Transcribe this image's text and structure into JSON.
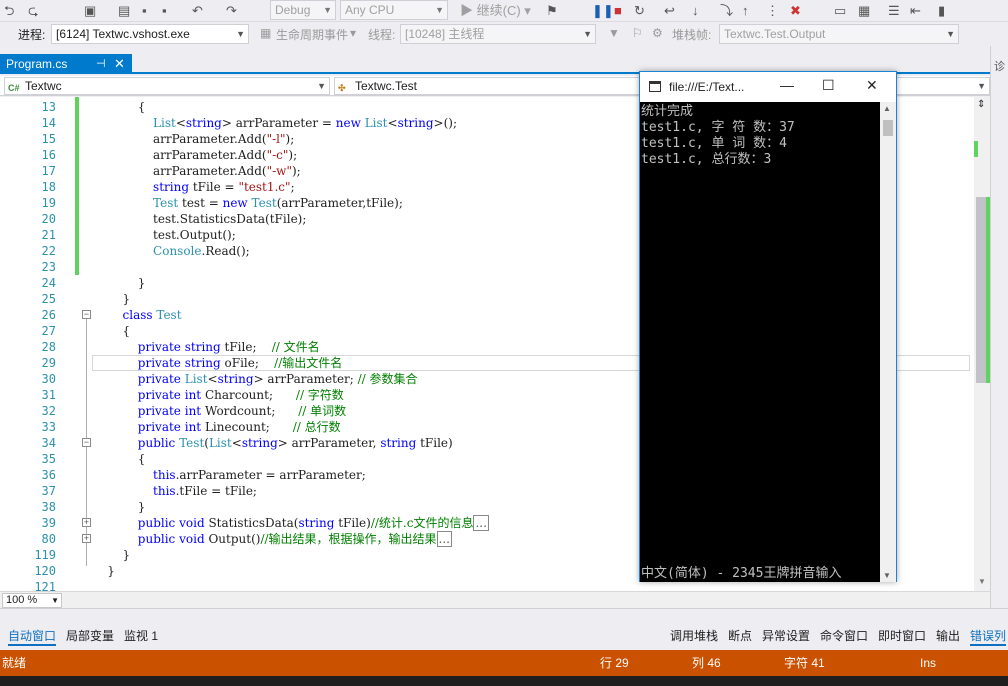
{
  "toolbar": {
    "config": "Debug",
    "platform": "Any CPU",
    "continue": "继续(C)"
  },
  "debug_bar": {
    "process_label": "进程:",
    "process_value": "[6124] Textwc.vshost.exe",
    "lifecycle": "生命周期事件",
    "thread_label": "线程:",
    "thread_value": "[10248] 主线程",
    "stack_label": "堆栈帧:",
    "stack_value": "Textwc.Test.Output"
  },
  "tab": {
    "name": "Program.cs",
    "pin": "⊣",
    "close": "✕"
  },
  "nav": {
    "project": "Textwc",
    "class": "Textwc.Test"
  },
  "code": [
    {
      "n": "13",
      "t": "            {"
    },
    {
      "n": "14",
      "t": "                <span class=\"t\">List</span>&lt;<span class=\"k\">string</span>&gt; arrParameter = <span class=\"k\">new</span> <span class=\"t\">List</span>&lt;<span class=\"k\">string</span>&gt;();"
    },
    {
      "n": "15",
      "t": "                arrParameter.Add(<span class=\"s\">\"-l\"</span>);"
    },
    {
      "n": "16",
      "t": "                arrParameter.Add(<span class=\"s\">\"-c\"</span>);"
    },
    {
      "n": "17",
      "t": "                arrParameter.Add(<span class=\"s\">\"-w\"</span>);"
    },
    {
      "n": "18",
      "t": "                <span class=\"k\">string</span> tFile = <span class=\"s\">\"test1.c\"</span>;"
    },
    {
      "n": "19",
      "t": "                <span class=\"t\">Test</span> test = <span class=\"k\">new</span> <span class=\"t\">Test</span>(arrParameter,tFile);"
    },
    {
      "n": "20",
      "t": "                test.StatisticsData(tFile);"
    },
    {
      "n": "21",
      "t": "                test.Output();"
    },
    {
      "n": "22",
      "t": "                <span class=\"t\">Console</span>.Read();"
    },
    {
      "n": "23",
      "t": ""
    },
    {
      "n": "24",
      "t": "            }"
    },
    {
      "n": "25",
      "t": "        }"
    },
    {
      "n": "26",
      "t": "        <span class=\"k\">class</span> <span class=\"t\">Test</span>"
    },
    {
      "n": "27",
      "t": "        {"
    },
    {
      "n": "28",
      "t": "            <span class=\"k\">private</span> <span class=\"k\">string</span> tFile;    <span class=\"c\">// 文件名</span>"
    },
    {
      "n": "29",
      "t": "            <span class=\"k\">private</span> <span class=\"k\">string</span> oFile;    <span class=\"c\">//输出文件名</span>"
    },
    {
      "n": "30",
      "t": "            <span class=\"k\">private</span> <span class=\"t\">List</span>&lt;<span class=\"k\">string</span>&gt; arrParameter; <span class=\"c\">// 参数集合</span>"
    },
    {
      "n": "31",
      "t": "            <span class=\"k\">private</span> <span class=\"k\">int</span> Charcount;      <span class=\"c\">// 字符数</span>"
    },
    {
      "n": "32",
      "t": "            <span class=\"k\">private</span> <span class=\"k\">int</span> Wordcount;      <span class=\"c\">// 单词数</span>"
    },
    {
      "n": "33",
      "t": "            <span class=\"k\">private</span> <span class=\"k\">int</span> Linecount;      <span class=\"c\">// 总行数</span>"
    },
    {
      "n": "34",
      "t": "            <span class=\"k\">public</span> <span class=\"t\">Test</span>(<span class=\"t\">List</span>&lt;<span class=\"k\">string</span>&gt; arrParameter, <span class=\"k\">string</span> tFile)"
    },
    {
      "n": "35",
      "t": "            {"
    },
    {
      "n": "36",
      "t": "                <span class=\"k\">this</span>.arrParameter = arrParameter;"
    },
    {
      "n": "37",
      "t": "                <span class=\"k\">this</span>.tFile = tFile;"
    },
    {
      "n": "38",
      "t": "            }"
    },
    {
      "n": "39",
      "t": "            <span class=\"k\">public</span> <span class=\"k\">void</span> StatisticsData(<span class=\"k\">string</span> tFile)<span class=\"c\">//统计.c文件的信息</span><span class=\"box\">...</span>"
    },
    {
      "n": "80",
      "t": "            <span class=\"k\">public</span> <span class=\"k\">void</span> Output()<span class=\"c\">//输出结果，根据操作，输出结果</span><span class=\"box\">...</span>"
    },
    {
      "n": "119",
      "t": "        }"
    },
    {
      "n": "120",
      "t": "    }"
    },
    {
      "n": "121",
      "t": ""
    }
  ],
  "zoom": "100 %",
  "bottom_tabs": {
    "left": [
      "自动窗口",
      "局部变量",
      "监视 1"
    ],
    "right": [
      "调用堆栈",
      "断点",
      "异常设置",
      "命令窗口",
      "即时窗口",
      "输出",
      "错误列"
    ]
  },
  "status": {
    "state": "就绪",
    "row": "行 29",
    "col": "列 46",
    "char": "字符 41",
    "mode": "Ins"
  },
  "console": {
    "title": "file:///E:/Text...",
    "minimize": "—",
    "maximize": "☐",
    "close": "✕",
    "lines": [
      "统计完成",
      "test1.c, 字 符 数：37",
      "test1.c, 单 词 数：4",
      "test1.c, 总行数：3"
    ],
    "ime": "中文(简体) - 2345王牌拼音输入"
  },
  "sidebar_label": "诊"
}
